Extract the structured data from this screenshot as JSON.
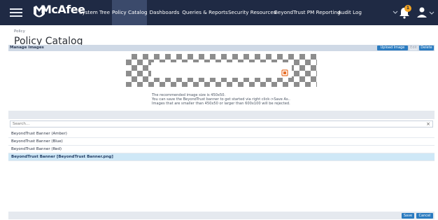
{
  "header": {
    "logo_text": "McAfee",
    "nav": [
      {
        "label": "System Tree"
      },
      {
        "label": "Policy Catalog"
      },
      {
        "label": "Dashboards"
      },
      {
        "label": "Queries & Reports"
      },
      {
        "label": "Security Resources"
      },
      {
        "label": "BeyondTrust PM Reporting"
      },
      {
        "label": "Audit Log"
      }
    ],
    "notification_count": "1"
  },
  "breadcrumb": "Policy",
  "page_title": "Policy Catalog",
  "section": {
    "title": "Manage Images",
    "buttons": {
      "upload": "Upload Image",
      "edit": "Edit",
      "delete": "Delete"
    }
  },
  "hint": {
    "line1": "The recommended image size is 450x50.",
    "line2": "You can save the BeyondTrust banner to get started via right click->Save As..",
    "line3": "Images that are smaller than 450x50 or larger than 600x100 will be rejected."
  },
  "search": {
    "placeholder": "Search...",
    "clear": "×"
  },
  "list": [
    {
      "label": "BeyondTrust Banner (Amber)",
      "selected": false
    },
    {
      "label": "BeyondTrust Banner (Blue)",
      "selected": false
    },
    {
      "label": "BeyondTrust Banner (Red)",
      "selected": false
    },
    {
      "label": "BeyondTrust Banner [BeyondTrust Banner.png]",
      "selected": true
    }
  ],
  "footer": {
    "save": "Save",
    "cancel": "Cancel"
  },
  "colors": {
    "header_bg": "#1f2a44",
    "accent": "#2a7bc0",
    "selected_row": "#cfe8f7",
    "banner_icon": "#e8702a"
  },
  "icons": {
    "menu": "hamburger-icon",
    "logo": "mcafee-shield-icon",
    "notifications": "bell-icon",
    "user": "user-icon",
    "banner": "beyondtrust-logo-icon"
  }
}
